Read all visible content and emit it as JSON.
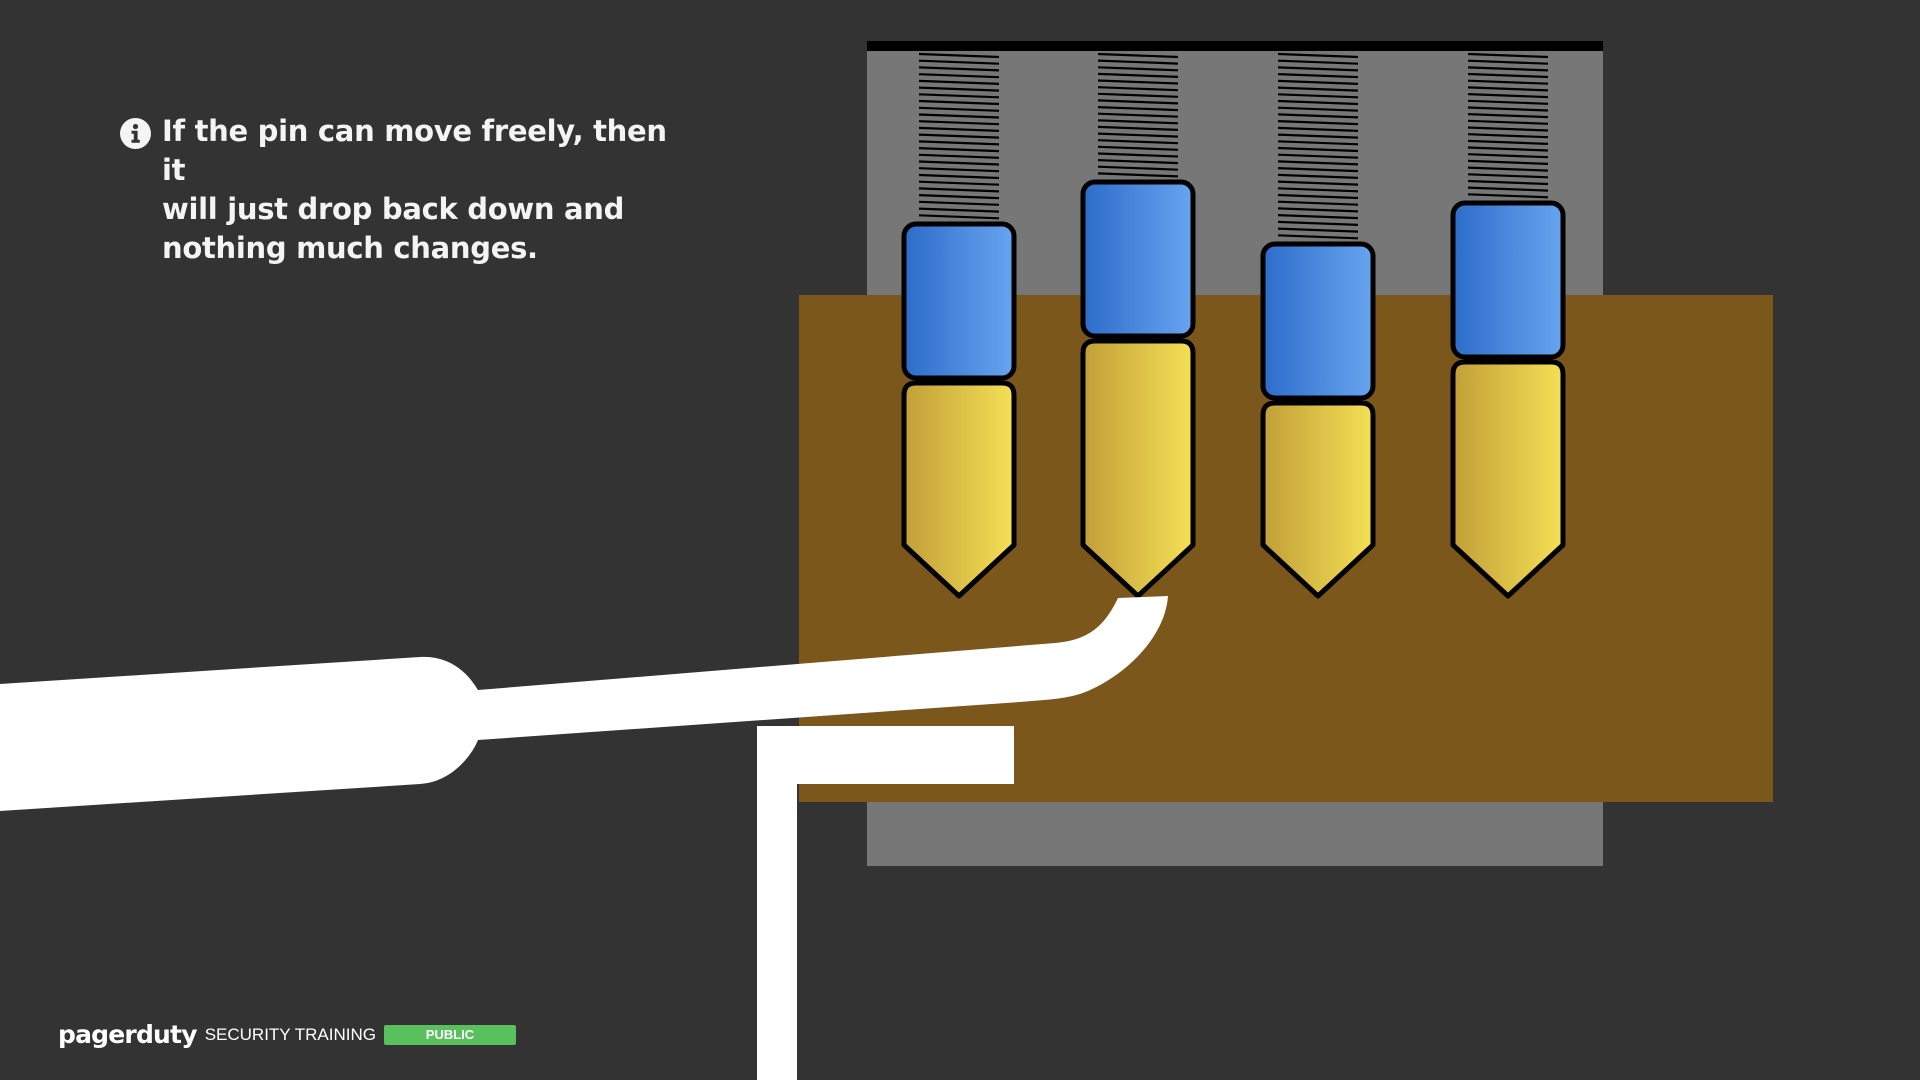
{
  "caption": {
    "icon": "info-icon",
    "text": "If the pin can move freely, then it\nwill just drop back down and\nnothing much changes."
  },
  "footer": {
    "brand": "pagerduty",
    "product": "SECURITY TRAINING",
    "badge": "PUBLIC",
    "badge_color": "#5ac05e"
  },
  "colors": {
    "background": "#333333",
    "lock_housing": "#777777",
    "plug": "#7b571c",
    "driver_pin": "#3f7fe0",
    "key_pin": "#e6cf4c",
    "tools": "#ffffff",
    "outline": "#000000"
  },
  "diagram": {
    "pins": [
      {
        "id": "pin-1",
        "lifted": false
      },
      {
        "id": "pin-2",
        "lifted": true
      },
      {
        "id": "pin-3",
        "lifted": false
      },
      {
        "id": "pin-4",
        "lifted": false
      }
    ],
    "tools": [
      "lock-pick",
      "tension-wrench"
    ]
  }
}
